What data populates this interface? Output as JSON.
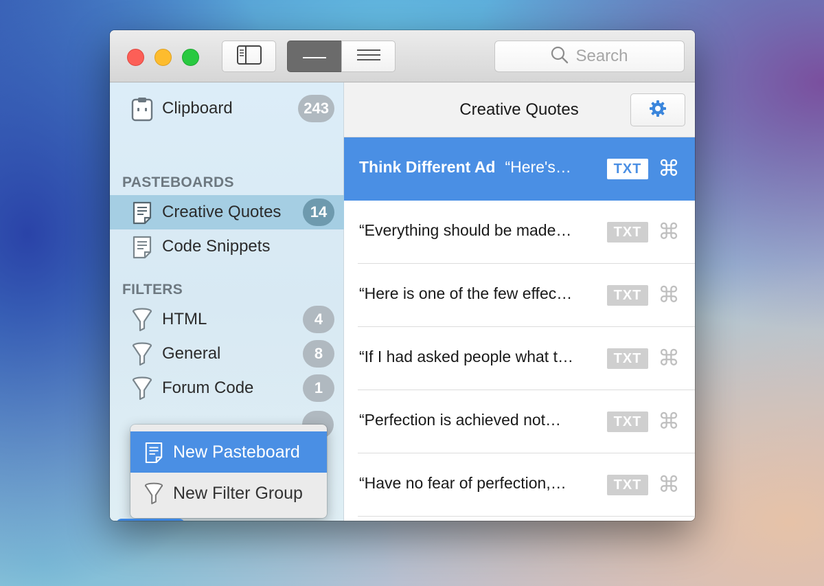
{
  "window": {
    "toolbar": {
      "search_placeholder": "Search",
      "icons": [
        "sidebar-toggle-icon",
        "single-line-view-icon",
        "multi-line-view-icon",
        "search-icon"
      ]
    },
    "sidebar": {
      "clipboard": {
        "label": "Clipboard",
        "count": "243"
      },
      "pasteboards_header": "PASTEBOARDS",
      "pasteboards": [
        {
          "label": "Creative Quotes",
          "count": "14",
          "selected": true
        },
        {
          "label": "Code Snippets",
          "count": ""
        }
      ],
      "filters_header": "FILTERS",
      "filters": [
        {
          "label": "HTML",
          "count": "4"
        },
        {
          "label": "General",
          "count": "8"
        },
        {
          "label": "Forum Code",
          "count": "1"
        }
      ],
      "add_label": "+"
    },
    "popup_menu": {
      "items": [
        {
          "label": "New Pasteboard",
          "icon": "pasteboard-icon",
          "highlighted": true
        },
        {
          "label": "New Filter Group",
          "icon": "filter-icon",
          "highlighted": false
        }
      ]
    },
    "main": {
      "title": "Creative Quotes",
      "settings_icon": "gear-icon",
      "clips": [
        {
          "title": "Think Different Ad",
          "preview": "“Here's…",
          "type": "TXT",
          "selected": true
        },
        {
          "title": "",
          "preview": "“Everything should be made…",
          "type": "TXT"
        },
        {
          "title": "",
          "preview": "“Here is one of the few effec…",
          "type": "TXT"
        },
        {
          "title": "",
          "preview": "“If I had asked people what t…",
          "type": "TXT"
        },
        {
          "title": "",
          "preview": "“Perfection is achieved not…",
          "type": "TXT"
        },
        {
          "title": "",
          "preview": "“Have no fear of perfection,…",
          "type": "TXT"
        }
      ]
    },
    "colors": {
      "accent": "#4a8fe4",
      "sidebar_selected": "#a5cee3",
      "badge": "#b0b9c0",
      "traffic_red": "#fc5f57",
      "traffic_yellow": "#fdbc2e",
      "traffic_green": "#29c940"
    }
  }
}
